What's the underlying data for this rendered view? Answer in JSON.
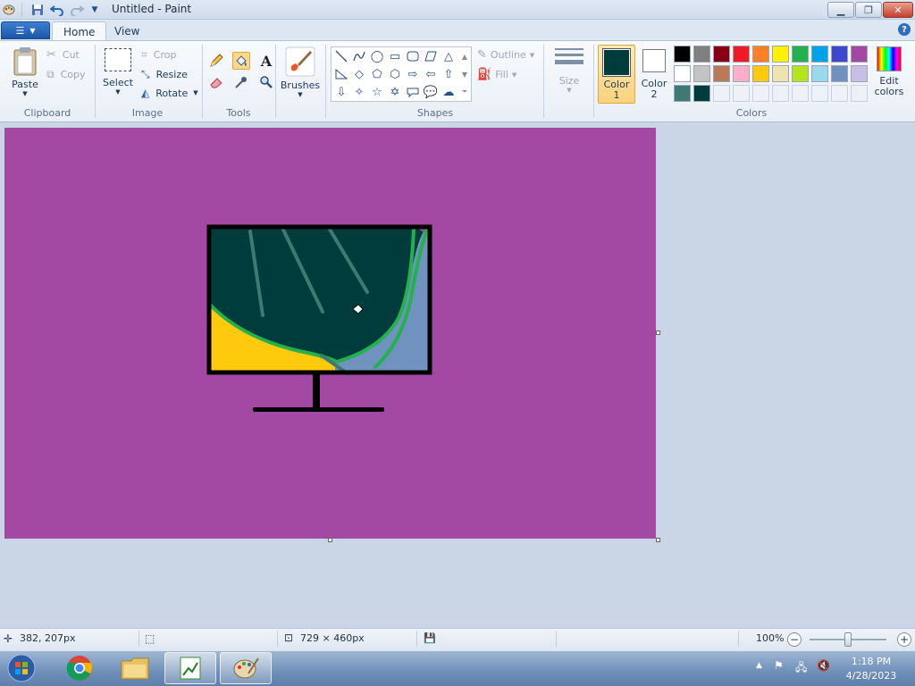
{
  "app": {
    "title": "Untitled - Paint"
  },
  "tabs": [
    {
      "label": "Home"
    },
    {
      "label": "View"
    }
  ],
  "clipboard": {
    "paste": "Paste",
    "cut": "Cut",
    "copy": "Copy",
    "label": "Clipboard"
  },
  "image": {
    "select": "Select",
    "crop": "Crop",
    "resize": "Resize",
    "rotate": "Rotate",
    "label": "Image"
  },
  "tools": {
    "label": "Tools",
    "active": "fill"
  },
  "brushes": {
    "label": "Brushes"
  },
  "shapes": {
    "label": "Shapes",
    "outline": "Outline",
    "fill": "Fill"
  },
  "size": {
    "label": "Size"
  },
  "colors": {
    "label": "Colors",
    "color1_label_a": "Color",
    "color1_label_b": "1",
    "color2_label_a": "Color",
    "color2_label_b": "2",
    "edit_a": "Edit",
    "edit_b": "colors",
    "color1": "#003c3c",
    "color2": "#ffffff",
    "palette_row1": [
      "#000000",
      "#7f7f7f",
      "#880015",
      "#ed1c24",
      "#ff7f27",
      "#fff200",
      "#22b14c",
      "#00a2e8",
      "#3f48cc",
      "#a349a4"
    ],
    "palette_row2": [
      "#ffffff",
      "#c3c3c3",
      "#b97a57",
      "#ffaec9",
      "#ffc90e",
      "#efe4b0",
      "#b5e61d",
      "#99d9ea",
      "#7092be",
      "#c8bfe7"
    ],
    "palette_row3": [
      "#3d7a74",
      "#003c3c",
      "",
      "",
      "",
      "",
      "",
      "",
      "",
      ""
    ]
  },
  "drawing": {
    "background": "#a349a4",
    "screen": "#003c3c",
    "yellow": "#ffc90e",
    "blue": "#7092be",
    "green": "#22b14c",
    "streak": "#3d7a74"
  },
  "status": {
    "cursor": "382, 207px",
    "dimensions": "729 × 460px",
    "zoom": "100%",
    "zoom_level": 0.5
  },
  "clock": {
    "time": "1:18 PM",
    "date": "4/28/2023"
  }
}
